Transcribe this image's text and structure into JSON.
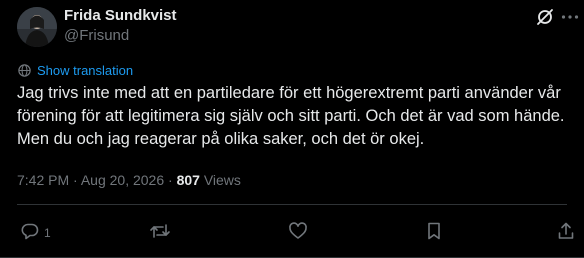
{
  "author": {
    "name": "Frida Sundkvist",
    "handle": "@Frisund"
  },
  "header_icons": [
    "grok-slash-icon",
    "more-dots-icon"
  ],
  "translation": {
    "label": "Show translation",
    "icon": "globe-icon"
  },
  "tweet": {
    "text": "Jag trivs inte med att en partiledare för ett högerextremt parti använder vår förening för att legitimera sig själv och sitt parti. Och det är vad som hände. Men du och jag reagerar på olika saker, och det ör okej."
  },
  "meta": {
    "time": "7:42 PM",
    "separator": "·",
    "date": "Aug 20, 2026",
    "views_count": "807",
    "views_label": "Views"
  },
  "actions": {
    "reply_count": "1",
    "icons": [
      "reply-icon",
      "retweet-icon",
      "like-icon",
      "bookmark-icon",
      "share-icon"
    ]
  },
  "colors": {
    "background": "#000000",
    "text": "#e7e9ea",
    "secondary": "#71767b",
    "accent": "#1d9bf0",
    "border": "#2f3336"
  }
}
